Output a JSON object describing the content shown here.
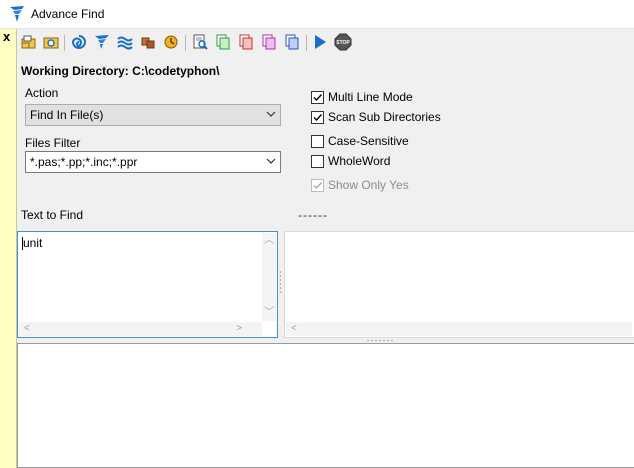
{
  "window": {
    "title": "Advance Find"
  },
  "panel": {
    "close_glyph": "x"
  },
  "toolbar": {
    "buttons": [
      {
        "icon": "open-folder-icon"
      },
      {
        "icon": "browse-folder-icon"
      },
      {
        "icon": "typhon-spiral-icon"
      },
      {
        "icon": "typhon-logo-icon"
      },
      {
        "icon": "typhon-waves-icon"
      },
      {
        "icon": "package-icon"
      },
      {
        "icon": "clock-icon"
      },
      {
        "icon": "find-in-files-icon"
      },
      {
        "icon": "copy-green-icon"
      },
      {
        "icon": "copy-red-icon"
      },
      {
        "icon": "copy-magenta-icon"
      },
      {
        "icon": "copy-blue-icon"
      },
      {
        "icon": "run-icon"
      },
      {
        "icon": "stop-icon"
      }
    ],
    "stop_text": "STOP"
  },
  "working_directory": "Working Directory: C:\\codetyphon\\",
  "action": {
    "label": "Action",
    "value": "Find In File(s)"
  },
  "files_filter": {
    "label": "Files Filter",
    "value": "*.pas;*.pp;*.inc;*.ppr"
  },
  "options": [
    {
      "label": "Multi Line Mode",
      "checked": true,
      "enabled": true
    },
    {
      "label": "Scan Sub Directories",
      "checked": true,
      "enabled": true
    },
    {
      "label": "Case-Sensitive",
      "checked": false,
      "enabled": true
    },
    {
      "label": "WholeWord",
      "checked": false,
      "enabled": true
    },
    {
      "label": "Show Only Yes",
      "checked": true,
      "enabled": false
    }
  ],
  "text_to_find": {
    "label": "Text to Find",
    "value": "unit"
  },
  "status_dashes": "------",
  "colors": {
    "strip": "#ffffc4",
    "accent_blue": "#1a6fc9",
    "focus_border": "#4a90c8"
  }
}
